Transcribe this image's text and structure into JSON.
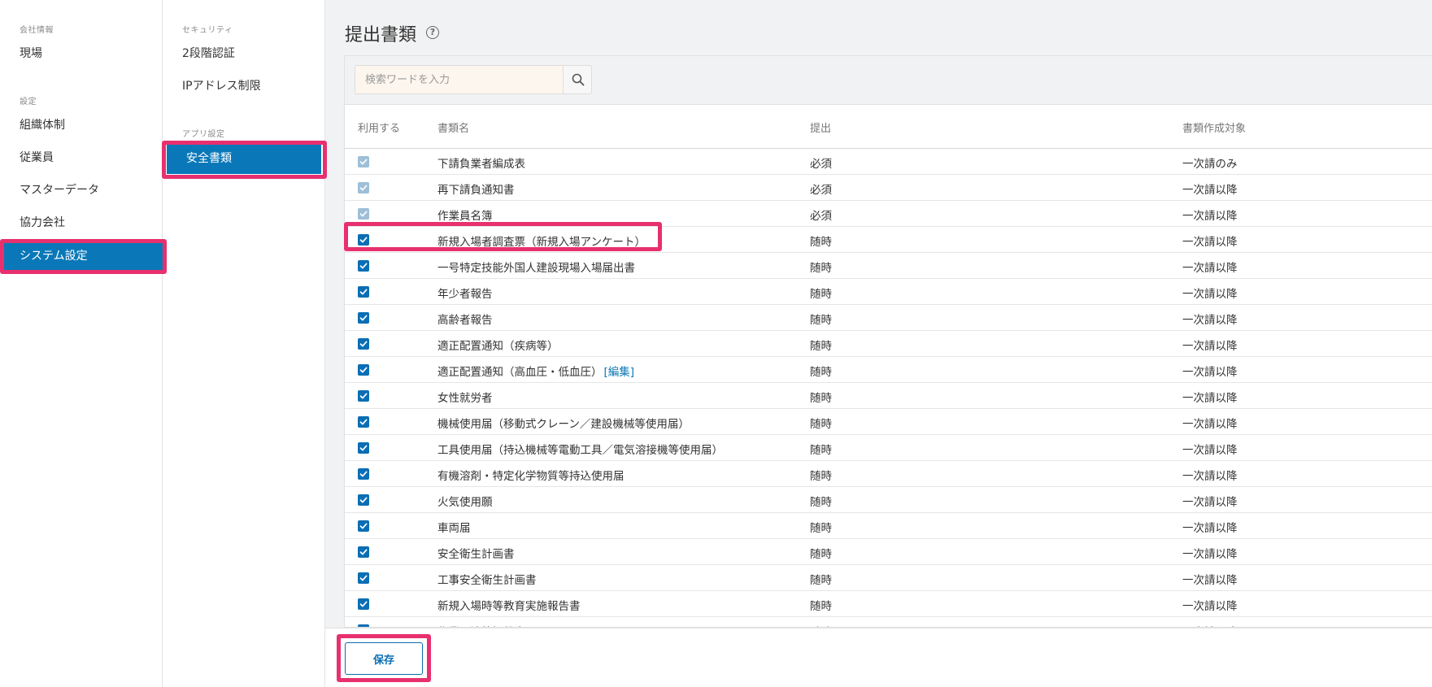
{
  "sidebar": {
    "sections": [
      {
        "label": "会社情報",
        "items": [
          {
            "label": "現場",
            "active": false
          }
        ]
      },
      {
        "label": "設定",
        "items": [
          {
            "label": "組織体制",
            "active": false
          },
          {
            "label": "従業員",
            "active": false
          },
          {
            "label": "マスターデータ",
            "active": false
          },
          {
            "label": "協力会社",
            "active": false
          },
          {
            "label": "システム設定",
            "active": true
          }
        ]
      }
    ]
  },
  "subnav": {
    "sections": [
      {
        "label": "セキュリティ",
        "items": [
          {
            "label": "2段階認証",
            "active": false
          },
          {
            "label": "IPアドレス制限",
            "active": false
          }
        ]
      },
      {
        "label": "アプリ設定",
        "items": [
          {
            "label": "安全書類",
            "active": true
          }
        ]
      }
    ]
  },
  "main": {
    "title": "提出書類",
    "help_glyph": "?",
    "search": {
      "placeholder": "検索ワードを入力",
      "value": ""
    },
    "table": {
      "headers": {
        "use": "利用する",
        "name": "書類名",
        "submit": "提出",
        "target": "書類作成対象"
      },
      "rows": [
        {
          "checked": true,
          "disabled": true,
          "name": "下請負業者編成表",
          "submit": "必須",
          "target": "一次請のみ"
        },
        {
          "checked": true,
          "disabled": true,
          "name": "再下請負通知書",
          "submit": "必須",
          "target": "一次請以降"
        },
        {
          "checked": true,
          "disabled": true,
          "name": "作業員名簿",
          "submit": "必須",
          "target": "一次請以降"
        },
        {
          "checked": true,
          "disabled": false,
          "name": "新規入場者調査票（新規入場アンケート）",
          "submit": "随時",
          "target": "一次請以降"
        },
        {
          "checked": true,
          "disabled": false,
          "name": "一号特定技能外国人建設現場入場届出書",
          "submit": "随時",
          "target": "一次請以降"
        },
        {
          "checked": true,
          "disabled": false,
          "name": "年少者報告",
          "submit": "随時",
          "target": "一次請以降"
        },
        {
          "checked": true,
          "disabled": false,
          "name": "高齢者報告",
          "submit": "随時",
          "target": "一次請以降"
        },
        {
          "checked": true,
          "disabled": false,
          "name": "適正配置通知（疾病等）",
          "submit": "随時",
          "target": "一次請以降"
        },
        {
          "checked": true,
          "disabled": false,
          "name": "適正配置通知（高血圧・低血圧）",
          "edit": "[編集]",
          "submit": "随時",
          "target": "一次請以降"
        },
        {
          "checked": true,
          "disabled": false,
          "name": "女性就労者",
          "submit": "随時",
          "target": "一次請以降"
        },
        {
          "checked": true,
          "disabled": false,
          "name": "機械使用届（移動式クレーン／建設機械等使用届）",
          "submit": "随時",
          "target": "一次請以降"
        },
        {
          "checked": true,
          "disabled": false,
          "name": "工具使用届（持込機械等電動工具／電気溶接機等使用届）",
          "submit": "随時",
          "target": "一次請以降"
        },
        {
          "checked": true,
          "disabled": false,
          "name": "有機溶剤・特定化学物質等持込使用届",
          "submit": "随時",
          "target": "一次請以降"
        },
        {
          "checked": true,
          "disabled": false,
          "name": "火気使用願",
          "submit": "随時",
          "target": "一次請以降"
        },
        {
          "checked": true,
          "disabled": false,
          "name": "車両届",
          "submit": "随時",
          "target": "一次請以降"
        },
        {
          "checked": true,
          "disabled": false,
          "name": "安全衛生計画書",
          "submit": "随時",
          "target": "一次請以降"
        },
        {
          "checked": true,
          "disabled": false,
          "name": "工事安全衛生計画書",
          "submit": "随時",
          "target": "一次請以降"
        },
        {
          "checked": true,
          "disabled": false,
          "name": "新規入場時等教育実施報告書",
          "submit": "随時",
          "target": "一次請以降"
        },
        {
          "checked": true,
          "disabled": false,
          "name": "作業間連絡調整書",
          "submit": "随時",
          "target": "一次請以降"
        }
      ]
    }
  },
  "footer": {
    "save_label": "保存"
  },
  "colors": {
    "accent": "#0a78b8",
    "highlight": "#e8306e",
    "checkbox": "#0a6eb4",
    "checkbox_disabled": "#9dbfd8"
  }
}
